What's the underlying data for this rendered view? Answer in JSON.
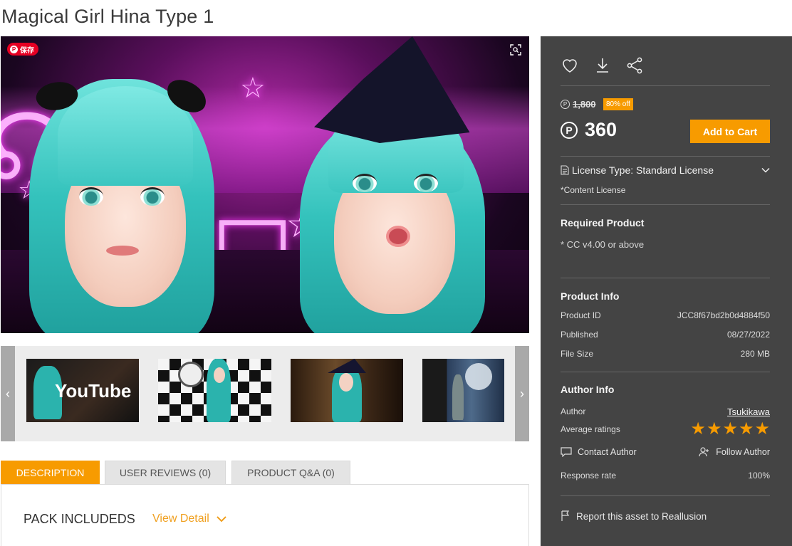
{
  "product": {
    "title": "Magical Girl Hina Type 1"
  },
  "image_overlay": {
    "pinterest_label": "保存",
    "pinterest_icon": "pinterest-icon",
    "lens_icon": "visual-search-icon"
  },
  "thumbnails": [
    {
      "name": "thumb-youtube",
      "text": "YouTube"
    },
    {
      "name": "thumb-clock-checkerboard"
    },
    {
      "name": "thumb-witch-room"
    },
    {
      "name": "thumb-moonlight"
    }
  ],
  "tabs": [
    {
      "label": "DESCRIPTION",
      "active": true
    },
    {
      "label": "USER REVIEWS (0)",
      "active": false
    },
    {
      "label": "PRODUCT Q&A (0)",
      "active": false
    }
  ],
  "description": {
    "pack_title": "PACK INCLUDEDS",
    "view_detail": "View Detail"
  },
  "sidebar": {
    "icons": [
      "heart-icon",
      "download-icon",
      "share-icon"
    ],
    "price": {
      "currency_symbol": "P",
      "original": "1,800",
      "discount_badge": "80% off",
      "current": "360",
      "add_to_cart": "Add to Cart"
    },
    "license": {
      "label": "License Type: Standard License",
      "note": "*Content License"
    },
    "required_product": {
      "title": "Required Product",
      "value": "* CC v4.00 or above"
    },
    "product_info": {
      "title": "Product Info",
      "rows": [
        {
          "key": "Product ID",
          "value": "JCC8f67bd2b0d4884f50"
        },
        {
          "key": "Published",
          "value": "08/27/2022"
        },
        {
          "key": "File Size",
          "value": "280 MB"
        }
      ]
    },
    "author_info": {
      "title": "Author Info",
      "author_label": "Author",
      "author_name": "Tsukikawa",
      "ratings_label": "Average ratings",
      "rating": 5,
      "rating_max": 5,
      "contact": "Contact Author",
      "follow": "Follow Author",
      "response_label": "Response rate",
      "response_value": "100%"
    },
    "report": "Report this asset to Reallusion"
  },
  "colors": {
    "accent": "#f79b00",
    "sidebar_bg": "#444444"
  }
}
